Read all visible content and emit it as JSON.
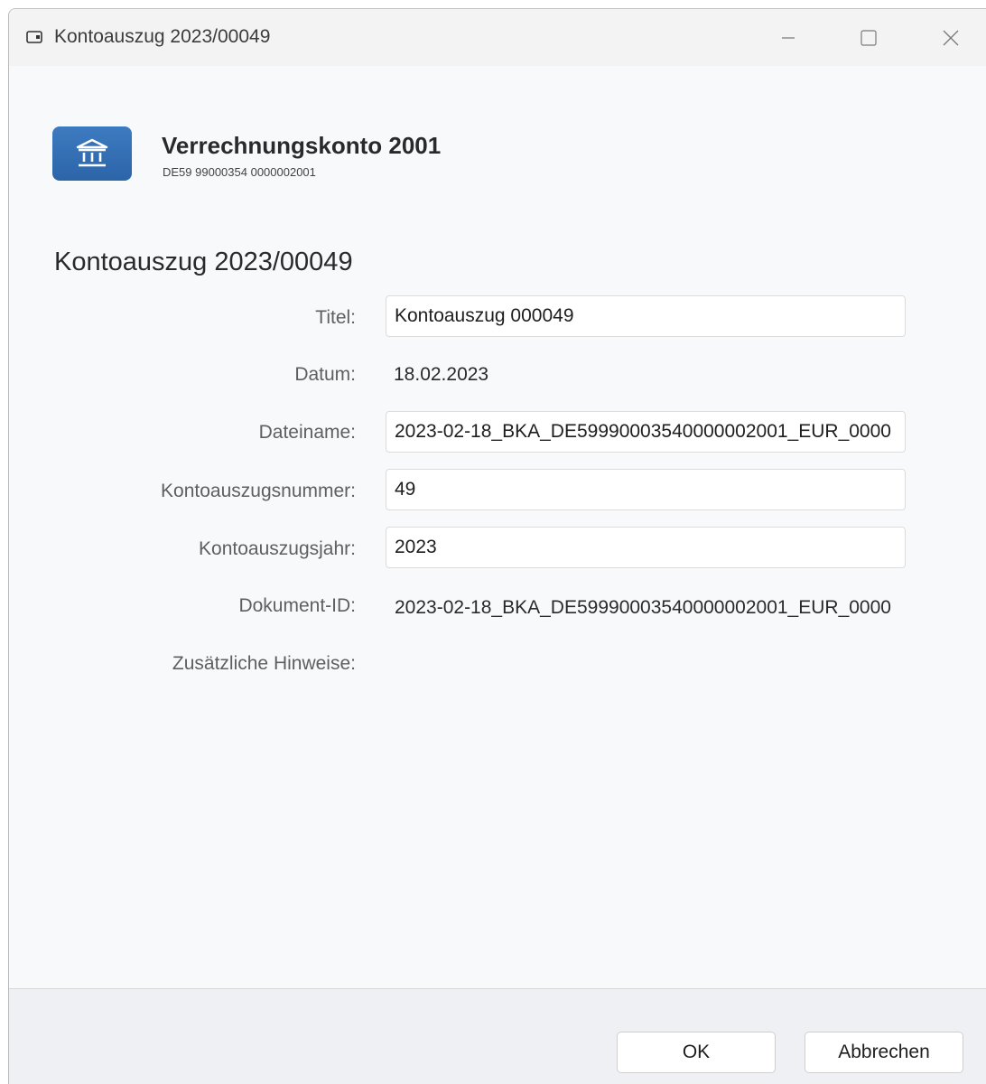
{
  "window": {
    "title": "Kontoauszug 2023/00049",
    "icons": {
      "app": "statement-window-icon",
      "minimize": "minimize-icon",
      "maximize": "maximize-icon",
      "close": "close-icon"
    }
  },
  "account": {
    "icon": "bank-icon",
    "name": "Verrechnungskonto 2001",
    "iban": "DE59 99000354 0000002001"
  },
  "section_title": "Kontoauszug 2023/00049",
  "form": {
    "titel_label": "Titel:",
    "titel_value": "Kontoauszug 000049",
    "datum_label": "Datum:",
    "datum_value": "18.02.2023",
    "dateiname_label": "Dateiname:",
    "dateiname_value": "2023-02-18_BKA_DE59990003540000002001_EUR_0000",
    "nummer_label": "Kontoauszugsnummer:",
    "nummer_value": "49",
    "jahr_label": "Kontoauszugsjahr:",
    "jahr_value": "2023",
    "dokument_label": "Dokument-ID:",
    "dokument_value": "2023-02-18_BKA_DE59990003540000002001_EUR_0000",
    "hinweise_label": "Zusätzliche Hinweise:"
  },
  "buttons": {
    "ok": "OK",
    "cancel": "Abbrechen"
  },
  "colors": {
    "accent": "#2c64a8",
    "window_bg": "#f8f9fb",
    "titlebar_bg": "#f3f3f3"
  }
}
